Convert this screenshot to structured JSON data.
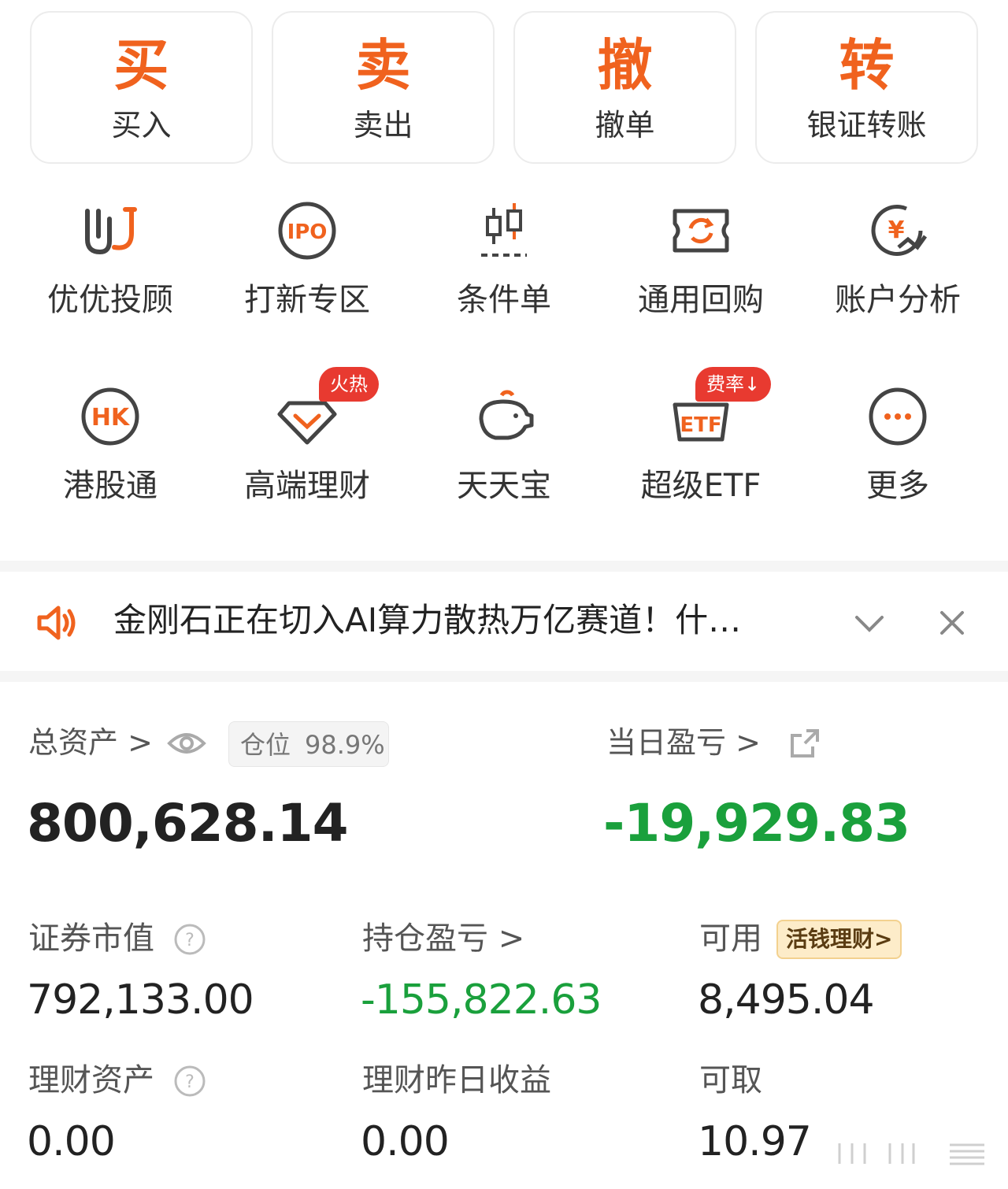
{
  "trade": [
    {
      "glyph": "买",
      "label": "买入"
    },
    {
      "glyph": "卖",
      "label": "卖出"
    },
    {
      "glyph": "撤",
      "label": "撤单"
    },
    {
      "glyph": "转",
      "label": "银证转账"
    }
  ],
  "grid_row1": [
    {
      "label": "优优投顾",
      "icon": "uu-advisor-icon"
    },
    {
      "label": "打新专区",
      "icon": "ipo-icon"
    },
    {
      "label": "条件单",
      "icon": "candlestick-icon"
    },
    {
      "label": "通用回购",
      "icon": "repurchase-icon"
    },
    {
      "label": "账户分析",
      "icon": "yuan-chart-icon"
    }
  ],
  "grid_row2": [
    {
      "label": "港股通",
      "icon": "hk-icon"
    },
    {
      "label": "高端理财",
      "icon": "diamond-icon",
      "tag": "火热"
    },
    {
      "label": "天天宝",
      "icon": "piggy-bank-icon"
    },
    {
      "label": "超级ETF",
      "icon": "etf-icon",
      "tag": "费率↓"
    },
    {
      "label": "更多",
      "icon": "more-icon"
    }
  ],
  "notice": {
    "text": "金刚石正在切入AI算力散热万亿赛道！什…"
  },
  "assets": {
    "total_label": "总资产 >",
    "position_label": "仓位",
    "position_value": "98.9%",
    "total_value": "800,628.14",
    "daily_pl_label": "当日盈亏 >",
    "daily_pl_value": "-19,929.83"
  },
  "metrics": {
    "market_value_label": "证券市值",
    "market_value": "792,133.00",
    "holding_pl_label": "持仓盈亏 >",
    "holding_pl": "-155,822.63",
    "available_label": "可用",
    "available_badge": "活钱理财>",
    "available": "8,495.04",
    "wealth_assets_label": "理财资产",
    "wealth_assets": "0.00",
    "wealth_yesterday_label": "理财昨日收益",
    "wealth_yesterday": "0.00",
    "withdrawable_label": "可取",
    "withdrawable": "10.97"
  },
  "colors": {
    "accent": "#f0621e",
    "loss": "#1aa03c",
    "tag": "#e83a30"
  }
}
